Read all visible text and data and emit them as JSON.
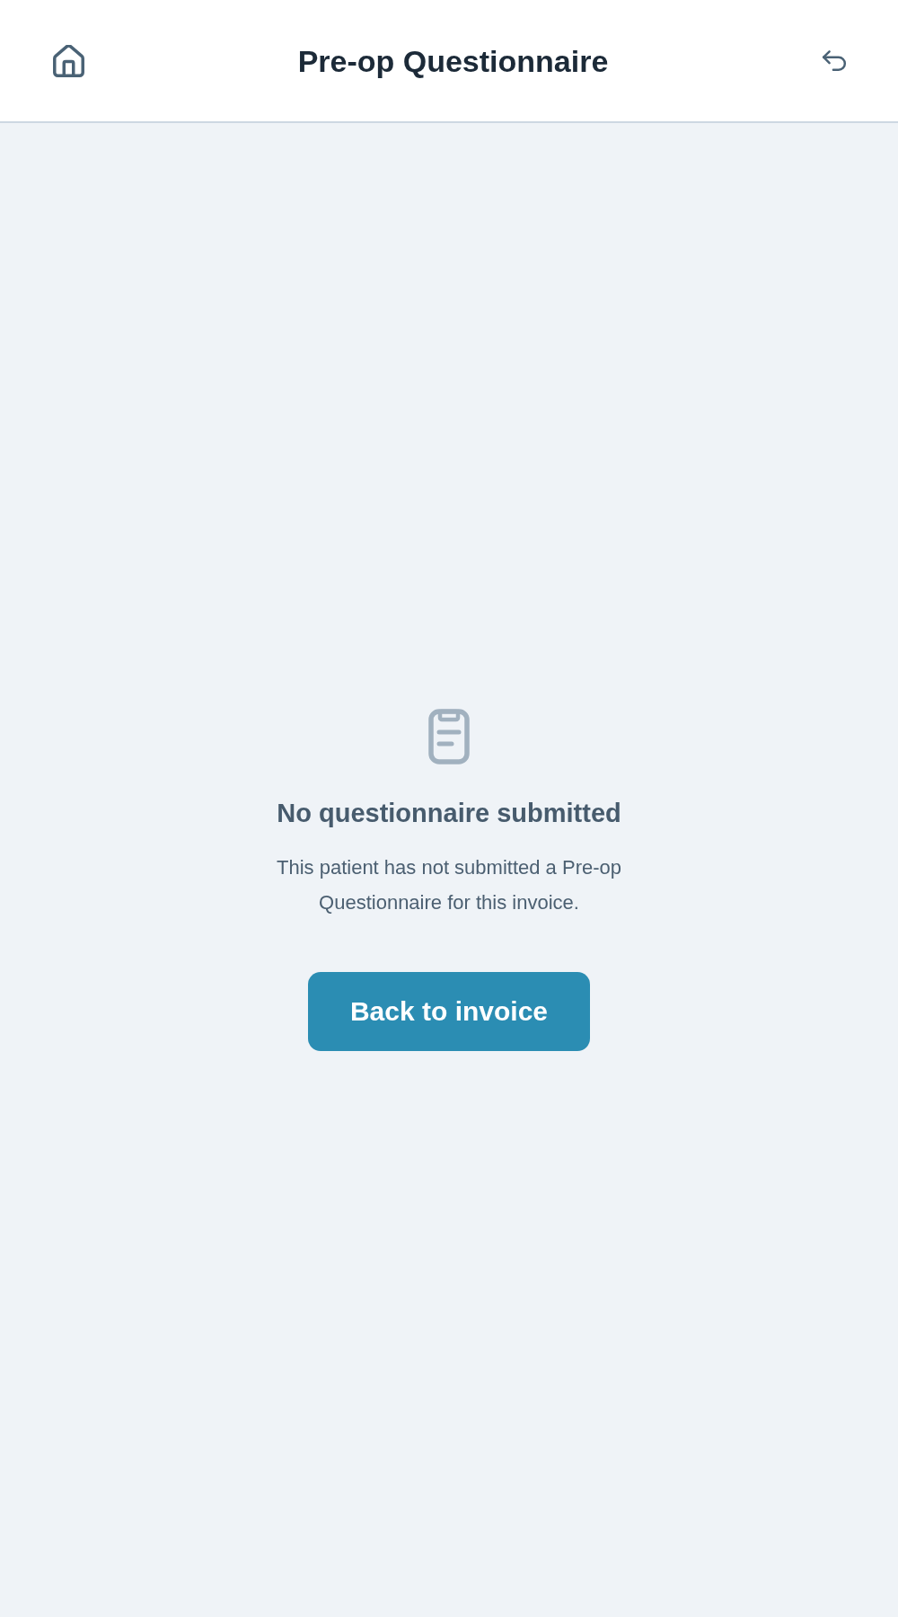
{
  "header": {
    "title": "Pre-op Questionnaire"
  },
  "empty_state": {
    "heading": "No questionnaire submitted",
    "message": "This patient has not submitted a Pre-op Questionnaire for this invoice.",
    "button": "Back to invoice"
  }
}
